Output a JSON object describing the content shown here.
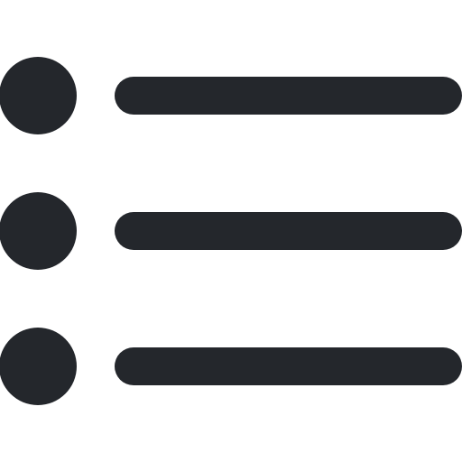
{
  "icon": {
    "name": "list-bullets-icon",
    "color": "#24272c",
    "rows": 3
  }
}
